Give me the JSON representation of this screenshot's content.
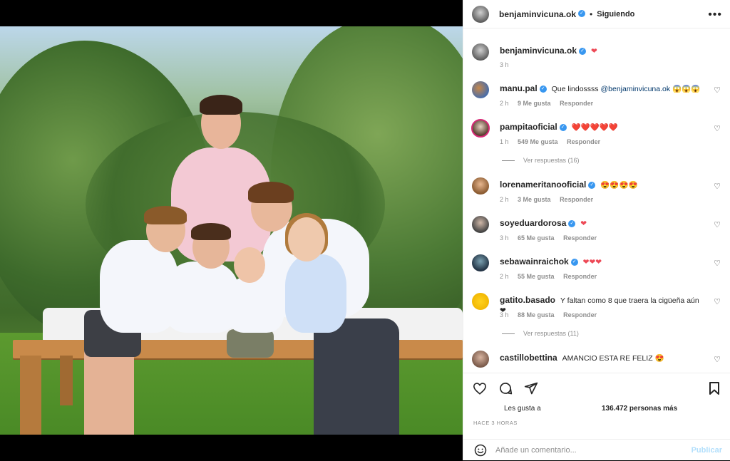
{
  "post": {
    "author": "benjaminvicuna.ok",
    "follow_state": "Siguiendo",
    "separator": "•",
    "more": "•••"
  },
  "caption": {
    "user": "benjaminvicuna.ok",
    "text": "❤",
    "time": "3 h"
  },
  "comments": [
    {
      "user": "manu.pal",
      "verified": true,
      "text_before": "Que lindossss ",
      "mention": "@benjaminvicuna.ok",
      "text_after": " 😱😱😱",
      "time": "2 h",
      "likes": "9 Me gusta",
      "reply": "Responder"
    },
    {
      "user": "pampitaoficial",
      "verified": true,
      "text": "❤️❤️❤️❤️❤️",
      "time": "1 h",
      "likes": "549 Me gusta",
      "reply": "Responder",
      "view_replies": "Ver respuestas (16)"
    },
    {
      "user": "lorenameritanooficial",
      "verified": true,
      "text": "😍😍😍😍",
      "time": "2 h",
      "likes": "3 Me gusta",
      "reply": "Responder"
    },
    {
      "user": "soyeduardorosa",
      "verified": true,
      "text": "❤",
      "time": "3 h",
      "likes": "65 Me gusta",
      "reply": "Responder"
    },
    {
      "user": "sebawainraichok",
      "verified": true,
      "text": "❤❤❤",
      "time": "2 h",
      "likes": "55 Me gusta",
      "reply": "Responder"
    },
    {
      "user": "gatito.basado",
      "verified": false,
      "text": "Y faltan como 8 que traera la cigüeña aún ❤",
      "time": "3 h",
      "likes": "88 Me gusta",
      "reply": "Responder",
      "view_replies": "Ver respuestas (11)"
    },
    {
      "user": "castillobettina",
      "verified": false,
      "text": "AMANCIO ESTA RE FELIZ 😍",
      "time": "",
      "likes": "",
      "reply": ""
    }
  ],
  "footer": {
    "likes_label": "Les gusta a",
    "likes_count": "136.472 personas más",
    "time_ago": "HACE 3 HORAS",
    "comment_placeholder": "Añade un comentario...",
    "publish": "Publicar"
  },
  "colors": {
    "verified": "#3897f0",
    "heart": "#ed4956",
    "link": "#00376b",
    "muted": "#8e8e8e",
    "publish_disabled": "#b2dffc"
  },
  "icons": {
    "like": "heart-outline-icon",
    "comment": "comment-bubble-icon",
    "share": "paper-plane-icon",
    "save": "bookmark-icon",
    "emoji": "smiley-icon",
    "more": "ellipsis-icon",
    "verified": "verified-badge-icon"
  }
}
